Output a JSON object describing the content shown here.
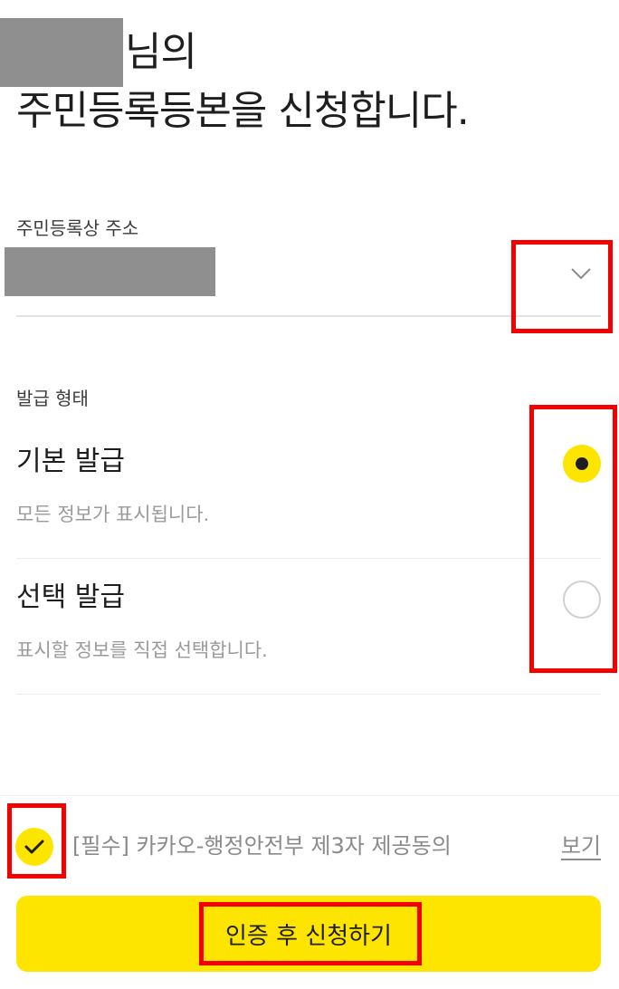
{
  "header": {
    "name_suffix": "님의",
    "title_highlight": "주민등록등본",
    "title_rest": "을 신청합니다."
  },
  "address": {
    "label": "주민등록상 주소"
  },
  "issuance": {
    "label": "발급 형태",
    "options": [
      {
        "title": "기본 발급",
        "description": "모든 정보가 표시됩니다.",
        "selected": true
      },
      {
        "title": "선택 발급",
        "description": "표시할 정보를 직접 선택합니다.",
        "selected": false
      }
    ]
  },
  "agreement": {
    "checked": true,
    "text": "[필수] 카카오-행정안전부 제3자 제공동의",
    "view_label": "보기"
  },
  "submit": {
    "label": "인증 후 신청하기"
  },
  "colors": {
    "accent": "#fee500",
    "annotation": "#f50000",
    "text": "#1e1e1e",
    "muted": "#9a9a9a"
  },
  "icons": {
    "dropdown": "chevron-down-icon",
    "radio_selected": "radio-selected-icon",
    "radio_unselected": "radio-unselected-icon",
    "agree": "check-icon"
  }
}
